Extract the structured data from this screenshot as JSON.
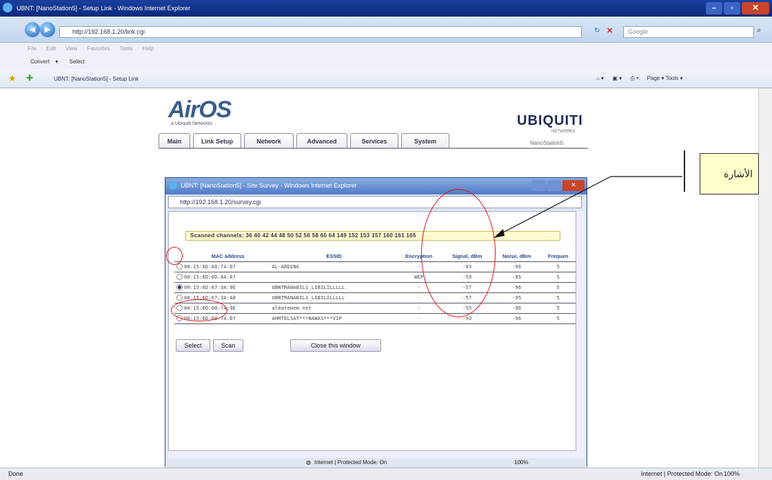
{
  "window": {
    "title": "UBNT: [NanoStation5] - Setup Link - Windows Internet Explorer",
    "url": "http://192.168.1.20/link.cgi",
    "search_placeholder": "Google",
    "menu": "File  Edit  View  Favorites  Tools  Help",
    "convert_label": "Convert",
    "select_label": "Select",
    "fav_tab": "UBNT: [NanoStation5] - Setup Link",
    "command_bar": "Page ▾   Tools ▾",
    "status_left": "Done",
    "status_zone": "Internet | Protected Mode: On",
    "status_zoom": "100%"
  },
  "page": {
    "logo": "AirOS",
    "logo_sub": "a Ubiquiti Networks",
    "brand": "UBIQUITI",
    "brand_sub": "NETWORKS",
    "device": "NanoStation5",
    "tabs": [
      "Main",
      "Link Setup",
      "Network",
      "Advanced",
      "Services",
      "System"
    ]
  },
  "popup": {
    "title": "UBNT: [NanoStation5] - Site Survey - Windows Internet Explorer",
    "url": "http://192.168.1.20/survey.cgi",
    "channels": "Scanned channels: 36 40 42 44 48 50 52 56 58 60 64 149 152 153 157 160 161 165",
    "headers": [
      "MAC address",
      "ESSID",
      "Encryption",
      "Signal, dBm",
      "Noise, dBm",
      "Frequen"
    ],
    "rows": [
      {
        "mac": "00:15:6D:60:7A:D7",
        "essid": "AL-AREENG",
        "enc": "-",
        "signal": "-93",
        "noise": "-96",
        "freq": "5"
      },
      {
        "mac": "00:15:6D:6D:8A:67",
        "essid": "",
        "enc": "WEP",
        "signal": "-59",
        "noise": "-95",
        "freq": "5"
      },
      {
        "mac": "00:15:6D:67:3A:9E",
        "essid": "UBNTMANABIL1_LIBILILLLLL",
        "enc": "-",
        "signal": "-57",
        "noise": "-96",
        "freq": "5"
      },
      {
        "mac": "00:15:6D:67:3A:A8",
        "essid": "UBNTMANABIL1_LIBILILLLLL",
        "enc": "-",
        "signal": "-57",
        "noise": "-95",
        "freq": "5"
      },
      {
        "mac": "00:15:6D:60:7A:9E",
        "essid": "almatemem net",
        "enc": "-",
        "signal": "-55",
        "noise": "-96",
        "freq": "5"
      },
      {
        "mac": "00:15:6D:60:7A:D7",
        "essid": "AHMTELSAT***NAWAS***VIP",
        "enc": "-",
        "signal": "-93",
        "noise": "-96",
        "freq": "5"
      }
    ],
    "select_button": "Select",
    "scan_button": "Scan",
    "close_button": "Close this window",
    "status_zone": "Internet | Protected Mode: On",
    "status_zoom": "100%"
  },
  "annotation": {
    "callout_text": "الأشارة"
  },
  "colors": {
    "titlebar": "#0a2a7a",
    "oval": "#e01010",
    "callout_bg": "#ffffcc"
  }
}
